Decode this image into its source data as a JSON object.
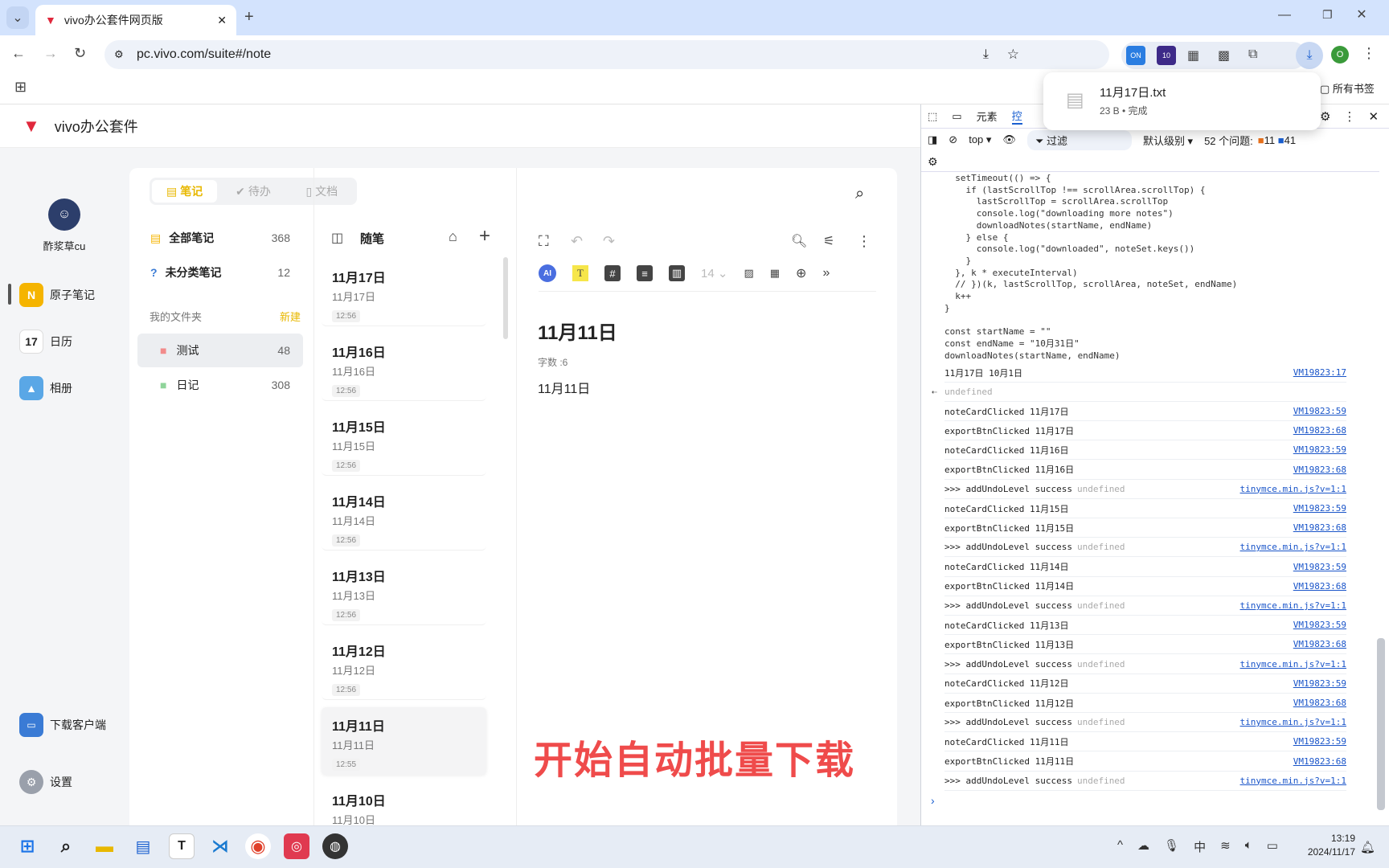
{
  "browser": {
    "tab_title": "vivo办公套件网页版",
    "url": "pc.vivo.com/suite#/note",
    "bookmarks_all": "所有书签",
    "ext_badge": "10",
    "profile": "O"
  },
  "download": {
    "filename": "11月17日.txt",
    "status": "23 B • 完成"
  },
  "app": {
    "title": "vivo办公套件",
    "user": "酢浆草cu",
    "nav": [
      {
        "label": "原子笔记",
        "icon": "N",
        "color": "#f5b400"
      },
      {
        "label": "日历",
        "icon": "17",
        "color": "#ffffff"
      },
      {
        "label": "相册",
        "icon": "▲",
        "color": "#5aa7e6"
      }
    ],
    "download_client": "下载客户端",
    "settings": "设置",
    "tabs": [
      "笔记",
      "待办",
      "文档"
    ],
    "all_notes": {
      "label": "全部笔记",
      "count": "368"
    },
    "uncategorized": {
      "label": "未分类笔记",
      "count": "12"
    },
    "folders_header": "我的文件夹",
    "new_folder": "新建",
    "folders": [
      {
        "label": "测试",
        "count": "48",
        "color": "#f28b8b"
      },
      {
        "label": "日记",
        "count": "308",
        "color": "#8fd49a"
      }
    ],
    "list_title": "随笔",
    "notes": [
      {
        "title": "11月17日",
        "sub": "11月17日",
        "time": "12:56"
      },
      {
        "title": "11月16日",
        "sub": "11月16日",
        "time": "12:56"
      },
      {
        "title": "11月15日",
        "sub": "11月15日",
        "time": "12:56"
      },
      {
        "title": "11月14日",
        "sub": "11月14日",
        "time": "12:56"
      },
      {
        "title": "11月13日",
        "sub": "11月13日",
        "time": "12:56"
      },
      {
        "title": "11月12日",
        "sub": "11月12日",
        "time": "12:56"
      },
      {
        "title": "11月11日",
        "sub": "11月11日",
        "time": "12:55"
      },
      {
        "title": "11月10日",
        "sub": "11月10日",
        "time": ""
      }
    ],
    "font_size": "14",
    "editor": {
      "title": "11月11日",
      "word_count": "字数 :6",
      "body": "11月11日"
    },
    "overlay": "开始自动批量下载"
  },
  "devtools": {
    "tabs": [
      "元素",
      "控"
    ],
    "context": "top ▾",
    "filter": "过滤",
    "level": "默认级别 ▾",
    "issues": "52 个问题:",
    "errors": "11",
    "infos": "41",
    "code": "  setTimeout(() => {\n    if (lastScrollTop !== scrollArea.scrollTop) {\n      lastScrollTop = scrollArea.scrollTop\n      console.log(\"downloading more notes\")\n      downloadNotes(startName, endName)\n    } else {\n      console.log(\"downloaded\", noteSet.keys())\n    }\n  }, k * executeInterval)\n  // })(k, lastScrollTop, scrollArea, noteSet, endName)\n  k++\n}\n\nconst startName = \"\"\nconst endName = \"10月31日\"\ndownloadNotes(startName, endName)",
    "first_log": {
      "text": "11月17日 10月1日",
      "src": "VM19823:17"
    },
    "return_value": "undefined",
    "logs": [
      {
        "text": "noteCardClicked 11月17日",
        "dim": "",
        "src": "VM19823:59"
      },
      {
        "text": "exportBtnClicked 11月17日",
        "dim": "",
        "src": "VM19823:68"
      },
      {
        "text": "noteCardClicked 11月16日",
        "dim": "",
        "src": "VM19823:59"
      },
      {
        "text": "exportBtnClicked 11月16日",
        "dim": "",
        "src": "VM19823:68"
      },
      {
        "text": ">>> addUndoLevel success",
        "dim": "undefined",
        "src": "tinymce.min.js?v=1:1"
      },
      {
        "text": "noteCardClicked 11月15日",
        "dim": "",
        "src": "VM19823:59"
      },
      {
        "text": "exportBtnClicked 11月15日",
        "dim": "",
        "src": "VM19823:68"
      },
      {
        "text": ">>> addUndoLevel success",
        "dim": "undefined",
        "src": "tinymce.min.js?v=1:1"
      },
      {
        "text": "noteCardClicked 11月14日",
        "dim": "",
        "src": "VM19823:59"
      },
      {
        "text": "exportBtnClicked 11月14日",
        "dim": "",
        "src": "VM19823:68"
      },
      {
        "text": ">>> addUndoLevel success",
        "dim": "undefined",
        "src": "tinymce.min.js?v=1:1"
      },
      {
        "text": "noteCardClicked 11月13日",
        "dim": "",
        "src": "VM19823:59"
      },
      {
        "text": "exportBtnClicked 11月13日",
        "dim": "",
        "src": "VM19823:68"
      },
      {
        "text": ">>> addUndoLevel success",
        "dim": "undefined",
        "src": "tinymce.min.js?v=1:1"
      },
      {
        "text": "noteCardClicked 11月12日",
        "dim": "",
        "src": "VM19823:59"
      },
      {
        "text": "exportBtnClicked 11月12日",
        "dim": "",
        "src": "VM19823:68"
      },
      {
        "text": ">>> addUndoLevel success",
        "dim": "undefined",
        "src": "tinymce.min.js?v=1:1"
      },
      {
        "text": "noteCardClicked 11月11日",
        "dim": "",
        "src": "VM19823:59"
      },
      {
        "text": "exportBtnClicked 11月11日",
        "dim": "",
        "src": "VM19823:68"
      },
      {
        "text": ">>> addUndoLevel success",
        "dim": "undefined",
        "src": "tinymce.min.js?v=1:1"
      }
    ]
  },
  "taskbar": {
    "time": "13:19",
    "date": "2024/11/17",
    "ime": "中"
  }
}
